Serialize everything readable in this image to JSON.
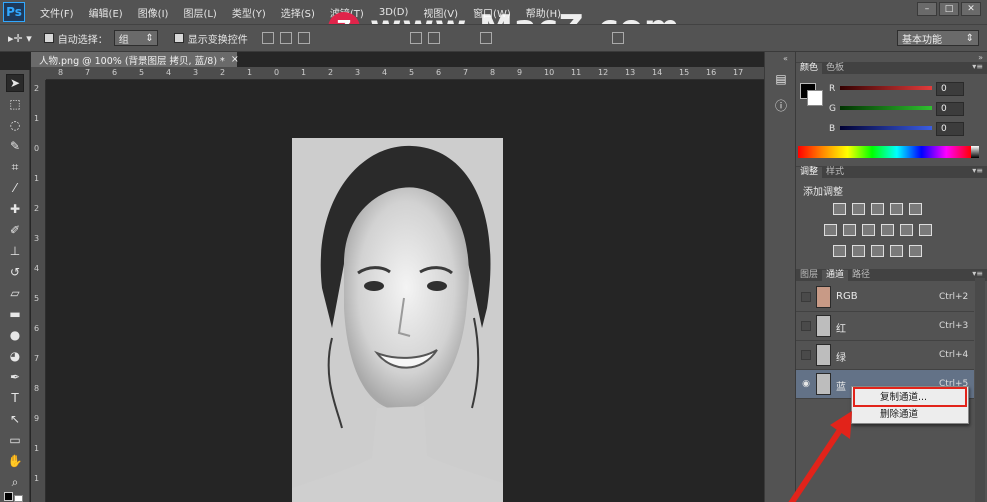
{
  "app": {
    "logo": "Ps"
  },
  "menu": [
    "文件(F)",
    "编辑(E)",
    "图像(I)",
    "图层(L)",
    "类型(Y)",
    "选择(S)",
    "滤镜(T)",
    "3D(D)",
    "视图(V)",
    "窗口(W)",
    "帮助(H)"
  ],
  "window_controls": {
    "minimize": "–",
    "maximize": "□",
    "close": "✕"
  },
  "watermark": {
    "logo": "Z",
    "text": "www.MacZ.com"
  },
  "options": {
    "auto_select_label": "自动选择：",
    "auto_select_value": "组",
    "show_transform_label": "显示变换控件",
    "workspace": "基本功能"
  },
  "document": {
    "tab_title": "人物.png @ 100% (背景图层 拷贝, 蓝/8) *",
    "tab_close": "×"
  },
  "rulers": {
    "top": [
      "8",
      "7",
      "6",
      "5",
      "4",
      "3",
      "2",
      "1",
      "0",
      "1",
      "2",
      "3",
      "4",
      "5",
      "6",
      "7",
      "8",
      "9",
      "10",
      "11",
      "12",
      "13",
      "14",
      "15",
      "16",
      "17"
    ],
    "left": [
      "2",
      "1",
      "0",
      "1",
      "2",
      "3",
      "4",
      "5",
      "6",
      "7",
      "8",
      "9",
      "1",
      "1"
    ]
  },
  "color_panel": {
    "tabs": [
      "颜色",
      "色板"
    ],
    "channels": [
      {
        "label": "R",
        "value": "0",
        "color": "#e33c3c"
      },
      {
        "label": "G",
        "value": "0",
        "color": "#30c030"
      },
      {
        "label": "B",
        "value": "0",
        "color": "#3c5ee3"
      }
    ]
  },
  "adjust_panel": {
    "tabs": [
      "调整",
      "样式"
    ],
    "title": "添加调整"
  },
  "channels_panel": {
    "tabs": [
      "图层",
      "通道",
      "路径"
    ],
    "rows": [
      {
        "name": "RGB",
        "shortcut": "Ctrl+2"
      },
      {
        "name": "红",
        "shortcut": "Ctrl+3"
      },
      {
        "name": "绿",
        "shortcut": "Ctrl+4"
      },
      {
        "name": "蓝",
        "shortcut": "Ctrl+5"
      }
    ]
  },
  "context_menu": {
    "items": [
      "复制通道...",
      "删除通道"
    ],
    "highlight_color": "#e2231a"
  }
}
